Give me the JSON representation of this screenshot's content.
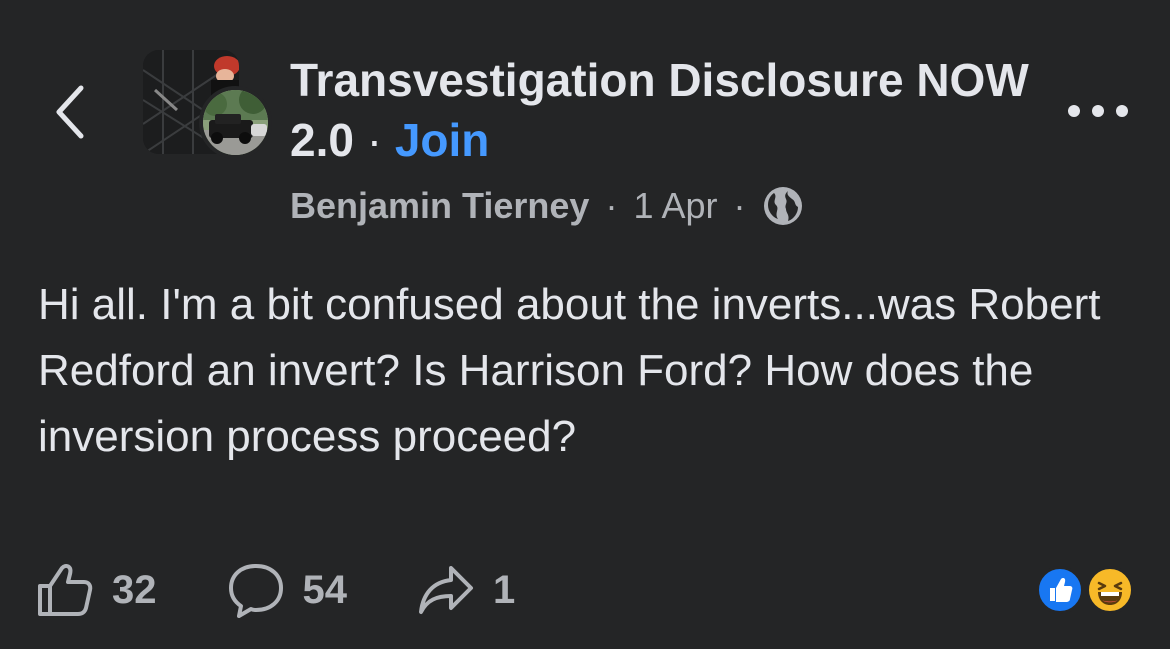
{
  "header": {
    "back_icon": "chevron-left-icon",
    "group_name": "Transvestigation Disclosure NOW 2.0",
    "separator": " · ",
    "join_label": "Join",
    "join_color": "#4599ff",
    "more_icon": "more-horizontal-icon"
  },
  "meta": {
    "author": "Benjamin Tierney",
    "sep1": "·",
    "date": "1 Apr",
    "sep2": "·",
    "privacy_icon": "globe-icon"
  },
  "post": {
    "text": "Hi all. I'm a bit confused about the inverts...was Robert Redford an invert? Is Harrison Ford? How does the inversion process proceed?"
  },
  "actions": {
    "like_count": "32",
    "comment_count": "54",
    "share_count": "1"
  },
  "reactions": [
    "like",
    "haha"
  ],
  "colors": {
    "background": "#242526",
    "text_primary": "#e4e6eb",
    "text_secondary": "#b0b3b8",
    "like_blue": "#1877f2",
    "haha_yellow": "#f7b928"
  }
}
